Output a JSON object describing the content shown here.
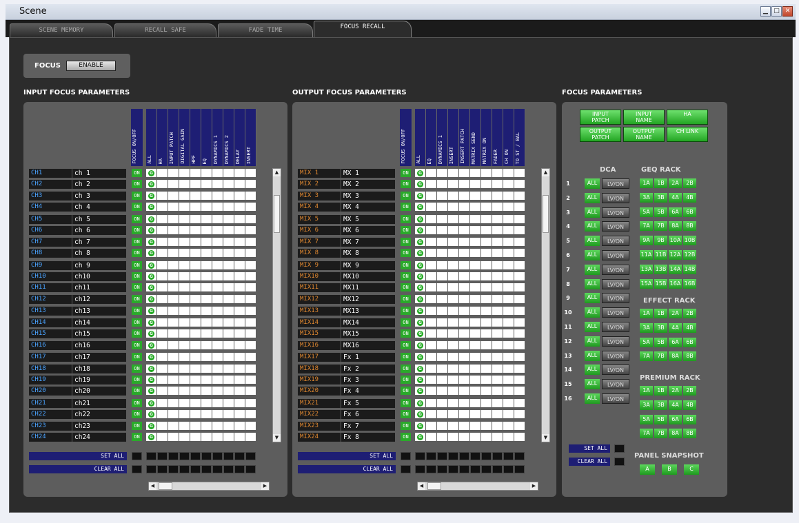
{
  "window": {
    "title": "Scene"
  },
  "tabs": [
    "SCENE MEMORY",
    "RECALL SAFE",
    "FADE TIME",
    "FOCUS RECALL"
  ],
  "focus": {
    "label": "FOCUS",
    "enable_label": "ENABLE"
  },
  "input": {
    "title": "INPUT FOCUS PARAMETERS",
    "headers": [
      "FOCUS ON/OFF",
      "ALL",
      "HA",
      "INPUT PATCH",
      "DIGITAL GAIN",
      "HPF",
      "EQ",
      "DYNAMICS 1",
      "DYNAMICS 2",
      "DELAY",
      "INSERT"
    ],
    "ids": [
      "CH1",
      "CH2",
      "CH3",
      "CH4",
      "CH5",
      "CH6",
      "CH7",
      "CH8",
      "CH9",
      "CH10",
      "CH11",
      "CH12",
      "CH13",
      "CH14",
      "CH15",
      "CH16",
      "CH17",
      "CH18",
      "CH19",
      "CH20",
      "CH21",
      "CH22",
      "CH23",
      "CH24"
    ],
    "names": [
      "ch 1",
      "ch 2",
      "ch 3",
      "ch 4",
      "ch 5",
      "ch 6",
      "ch 7",
      "ch 8",
      "ch 9",
      "ch10",
      "ch11",
      "ch12",
      "ch13",
      "ch14",
      "ch15",
      "ch16",
      "ch17",
      "ch18",
      "ch19",
      "ch20",
      "ch21",
      "ch22",
      "ch23",
      "ch24"
    ]
  },
  "output": {
    "title": "OUTPUT FOCUS PARAMETERS",
    "headers": [
      "FOCUS ON/OFF",
      "ALL",
      "EQ",
      "DYNAMICS 1",
      "INSERT",
      "INSERT PATCH",
      "MATRIX SEND",
      "MATRIX ON",
      "FADER",
      "CH ON",
      "TO ST / BAL"
    ],
    "ids": [
      "MIX 1",
      "MIX 2",
      "MIX 3",
      "MIX 4",
      "MIX 5",
      "MIX 6",
      "MIX 7",
      "MIX 8",
      "MIX 9",
      "MIX10",
      "MIX11",
      "MIX12",
      "MIX13",
      "MIX14",
      "MIX15",
      "MIX16",
      "MIX17",
      "MIX18",
      "MIX19",
      "MIX20",
      "MIX21",
      "MIX22",
      "MIX23",
      "MIX24"
    ],
    "names": [
      "MX 1",
      "MX 2",
      "MX 3",
      "MX 4",
      "MX 5",
      "MX 6",
      "MX 7",
      "MX 8",
      "MX 9",
      "MX10",
      "MX11",
      "MX12",
      "MX13",
      "MX14",
      "MX15",
      "MX16",
      "Fx 1",
      "Fx 2",
      "Fx 3",
      "Fx 4",
      "Fx 5",
      "Fx 6",
      "Fx 7",
      "Fx 8"
    ]
  },
  "on_label": "ON",
  "all_dot": "G",
  "set_all": "SET ALL",
  "clear_all": "CLEAR ALL",
  "focus_params": {
    "title": "FOCUS PARAMETERS",
    "buttons": [
      "INPUT PATCH",
      "INPUT NAME",
      "HA",
      "OUTPUT PATCH",
      "OUTPUT NAME",
      "CH LINK"
    ],
    "dca_title": "DCA",
    "dca_all": "ALL",
    "dca_lvon": "LV/ON",
    "dca_nums": [
      "1",
      "2",
      "3",
      "4",
      "5",
      "6",
      "7",
      "8",
      "9",
      "10",
      "11",
      "12",
      "13",
      "14",
      "15",
      "16"
    ],
    "geq_title": "GEQ RACK",
    "geq": [
      [
        "1A",
        "1B",
        "2A",
        "2B"
      ],
      [
        "3A",
        "3B",
        "4A",
        "4B"
      ],
      [
        "5A",
        "5B",
        "6A",
        "6B"
      ],
      [
        "7A",
        "7B",
        "8A",
        "8B"
      ],
      [
        "9A",
        "9B",
        "10A",
        "10B"
      ],
      [
        "11A",
        "11B",
        "12A",
        "12B"
      ],
      [
        "13A",
        "13B",
        "14A",
        "14B"
      ],
      [
        "15A",
        "15B",
        "16A",
        "16B"
      ]
    ],
    "effect_title": "EFFECT RACK",
    "effect": [
      [
        "1A",
        "1B",
        "2A",
        "2B"
      ],
      [
        "3A",
        "3B",
        "4A",
        "4B"
      ],
      [
        "5A",
        "5B",
        "6A",
        "6B"
      ],
      [
        "7A",
        "7B",
        "8A",
        "8B"
      ]
    ],
    "premium_title": "PREMIUM RACK",
    "premium": [
      [
        "1A",
        "1B",
        "2A",
        "2B"
      ],
      [
        "3A",
        "3B",
        "4A",
        "4B"
      ],
      [
        "5A",
        "5B",
        "6A",
        "6B"
      ],
      [
        "7A",
        "7B",
        "8A",
        "8B"
      ]
    ],
    "panel_snapshot_title": "PANEL SNAPSHOT",
    "panel_snapshot": [
      "A",
      "B",
      "C"
    ]
  }
}
